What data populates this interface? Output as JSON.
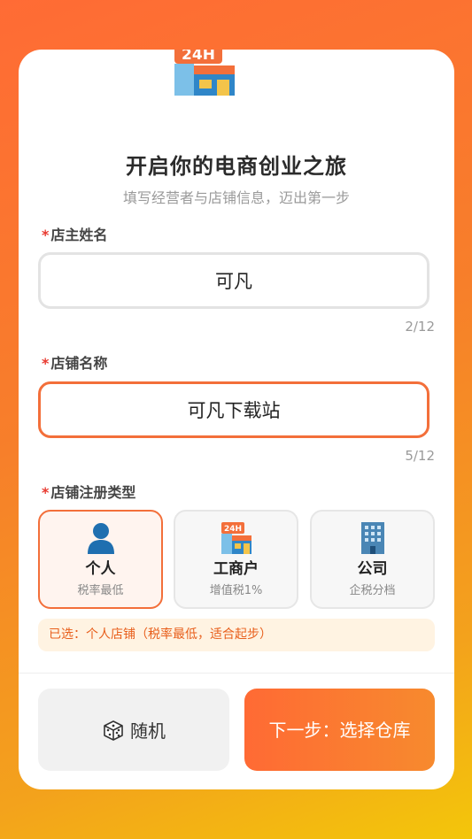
{
  "header": {
    "icon": "24h-store-icon",
    "title": "开启你的电商创业之旅",
    "subtitle": "填写经营者与店铺信息，迈出第一步"
  },
  "owner": {
    "required_mark": "*",
    "label": "店主姓名",
    "value": "可凡",
    "counter": "2/12"
  },
  "shop": {
    "required_mark": "*",
    "label": "店铺名称",
    "value": "可凡下载站",
    "counter": "5/12"
  },
  "reg_type": {
    "required_mark": "*",
    "label": "店铺注册类型",
    "options": [
      {
        "name": "个人",
        "desc": "税率最低",
        "icon": "person-icon",
        "selected": true
      },
      {
        "name": "工商户",
        "desc": "增值税1%",
        "icon": "24h-store-icon",
        "selected": false
      },
      {
        "name": "公司",
        "desc": "企税分档",
        "icon": "office-building-icon",
        "selected": false
      }
    ],
    "notice": "已选：个人店铺（税率最低，适合起步）"
  },
  "footer": {
    "random_label": "随机",
    "random_icon": "dice-icon",
    "next_label": "下一步：选择仓库"
  },
  "colors": {
    "accent": "#f36f3a",
    "required": "#e8392f",
    "notice_bg": "#fff3e2"
  }
}
